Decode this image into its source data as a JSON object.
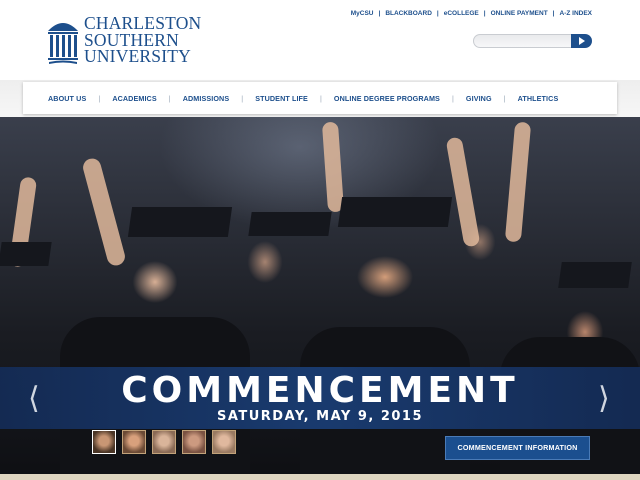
{
  "header": {
    "logo_lines": [
      "CHARLESTON",
      "SOUTHERN",
      "UNIVERSITY"
    ],
    "utility_links": [
      "MyCSU",
      "BLACKBOARD",
      "eCOLLEGE",
      "ONLINE PAYMENT",
      "A-Z INDEX"
    ],
    "search": {
      "placeholder": "",
      "value": "",
      "button_icon": "arrow-right-icon"
    }
  },
  "nav": {
    "items": [
      "ABOUT US",
      "ACADEMICS",
      "ADMISSIONS",
      "STUDENT LIFE",
      "ONLINE DEGREE PROGRAMS",
      "GIVING",
      "ATHLETICS"
    ]
  },
  "hero": {
    "title": "COMMENCEMENT",
    "subtitle": "SATURDAY, MAY 9, 2015",
    "prev_icon": "chevron-left-icon",
    "next_icon": "chevron-right-icon",
    "thumb_count": 5,
    "active_thumb": 0,
    "cta_label": "COMMENCEMENT INFORMATION"
  },
  "colors": {
    "brand_blue": "#1d4f8c",
    "banner_blue": "#1b4f8f",
    "bottom_bar": "#ded5c0"
  }
}
